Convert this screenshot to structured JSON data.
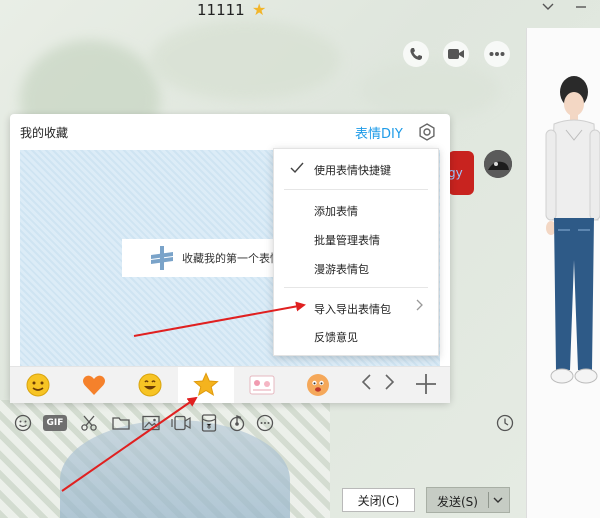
{
  "window": {
    "title": "11111",
    "title_badge_icon": "star-icon",
    "controls": [
      "chevron-down-icon",
      "minimize-icon"
    ]
  },
  "header_actions": [
    "phone-icon",
    "video-icon",
    "more-icon"
  ],
  "favorites_panel": {
    "title": "我的收藏",
    "diy_link": "表情DIY",
    "settings_icon": "gear-icon",
    "empty_hint": "收藏我的第一个表情"
  },
  "context_menu": {
    "items": [
      {
        "label": "使用表情快捷键",
        "checked": true
      },
      {
        "label": "添加表情"
      },
      {
        "label": "批量管理表情"
      },
      {
        "label": "漫游表情包"
      },
      {
        "label": "导入导出表情包",
        "has_submenu": true
      },
      {
        "label": "反馈意见"
      }
    ]
  },
  "chat": {
    "bubble_text": "gy"
  },
  "emoji_tabs": [
    {
      "icon": "smile-emoji-icon"
    },
    {
      "icon": "heart-icon"
    },
    {
      "icon": "grin-emoji-icon"
    },
    {
      "icon": "star-icon",
      "active": true
    },
    {
      "icon": "sticker-pack-icon"
    },
    {
      "icon": "character-emoji-icon"
    }
  ],
  "toolbar": {
    "tools": [
      "emoji-icon",
      "gif-icon",
      "scissors-icon",
      "folder-icon",
      "image-icon",
      "screen-record-icon",
      "red-envelope-icon",
      "music-icon",
      "more-icon"
    ],
    "gif_label": "GIF",
    "history_icon": "clock-icon"
  },
  "footer": {
    "close_label": "关闭(C)",
    "send_label": "发送(S)"
  },
  "colors": {
    "accent_blue": "#1e9be8",
    "star_yellow": "#f2b52a",
    "arrow_red": "#e02020",
    "bubble_red": "#c8231f"
  }
}
